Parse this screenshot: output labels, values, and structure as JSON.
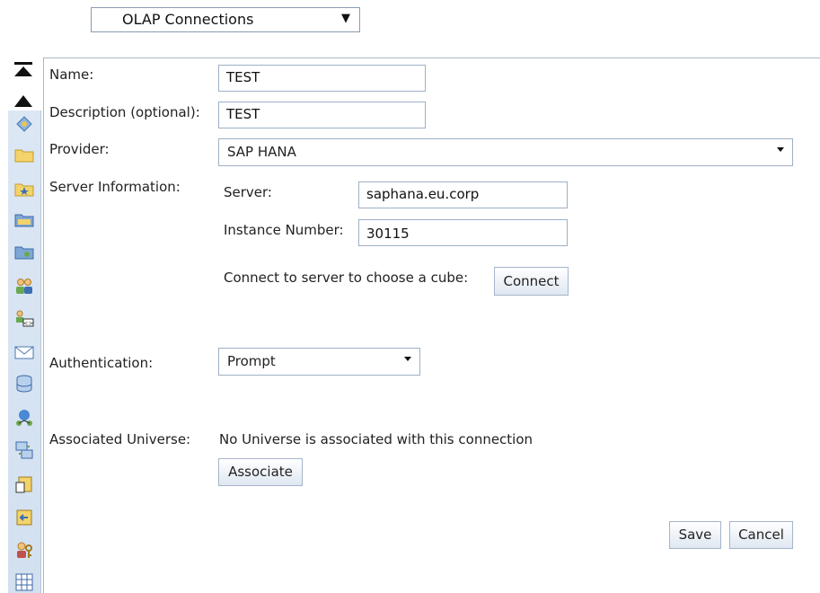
{
  "top_select": {
    "value": "OLAP Connections"
  },
  "form": {
    "name_label": "Name:",
    "name_value": "TEST",
    "description_label": "Description (optional):",
    "description_value": "TEST",
    "provider_label": "Provider:",
    "provider_value": "SAP HANA",
    "server_info_label": "Server Information:",
    "server_label": "Server:",
    "server_value": "saphana.eu.corp",
    "instance_label": "Instance Number:",
    "instance_value": "30115",
    "connect_prompt": "Connect to server to choose a cube:",
    "connect_button": "Connect",
    "auth_label": "Authentication:",
    "auth_value": "Prompt",
    "universe_label": "Associated Universe:",
    "universe_text": "No Universe is associated with this connection",
    "associate_button": "Associate",
    "save_button": "Save",
    "cancel_button": "Cancel"
  },
  "toolbar_icons": [
    "connection-icon",
    "folder-icon",
    "favorites-folder-icon",
    "inbox-folder-icon",
    "personal-folder-icon",
    "users-icon",
    "user-properties-icon",
    "mail-icon",
    "database-icon",
    "network-icon",
    "replication-icon",
    "cube-icon",
    "import-icon",
    "key-user-icon",
    "grid-icon"
  ],
  "colors": {
    "toolbar_bg": "#d6e3f2",
    "border": "#9eb0c6",
    "accent": "#3b6eb5"
  }
}
